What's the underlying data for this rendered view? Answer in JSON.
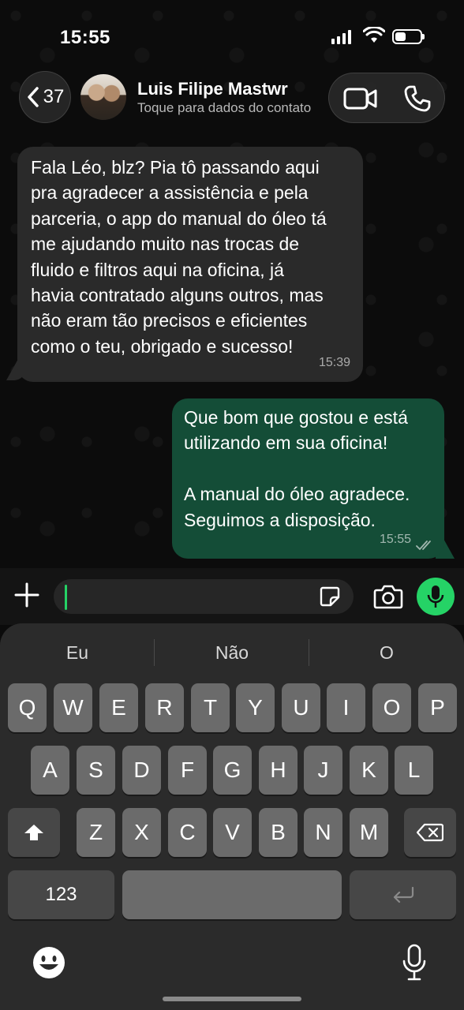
{
  "status_bar": {
    "time": "15:55"
  },
  "header": {
    "back_count": "37",
    "contact_name": "Luis Filipe Mastwr",
    "contact_subtitle": "Toque para dados do contato"
  },
  "messages": [
    {
      "direction": "incoming",
      "text": "Fala Léo, blz? Pia tô passando aqui\npra agradecer a assistência e pela\nparceria, o app do manual do óleo tá\nme ajudando muito nas trocas de\nfluido e filtros aqui na oficina, já\nhavia contratado alguns outros, mas\nnão eram tão precisos e eficientes\ncomo o teu, obrigado e sucesso!",
      "time": "15:39"
    },
    {
      "direction": "outgoing",
      "text": "Que bom que gostou e está\nutilizando em sua oficina!\n\nA manual do óleo agradece.\nSeguimos a disposição.",
      "time": "15:55",
      "status": "read-ticks-icon"
    }
  ],
  "composer": {
    "value": ""
  },
  "keyboard": {
    "suggestions": [
      "Eu",
      "Não",
      "O"
    ],
    "row1": [
      "Q",
      "W",
      "E",
      "R",
      "T",
      "Y",
      "U",
      "I",
      "O",
      "P"
    ],
    "row2": [
      "A",
      "S",
      "D",
      "F",
      "G",
      "H",
      "J",
      "K",
      "L"
    ],
    "row3": [
      "Z",
      "X",
      "C",
      "V",
      "B",
      "N",
      "M"
    ],
    "numbers_label": "123"
  },
  "colors": {
    "outgoing_bubble": "#144d37",
    "incoming_bubble": "#2a2a2a",
    "accent": "#25d366"
  }
}
